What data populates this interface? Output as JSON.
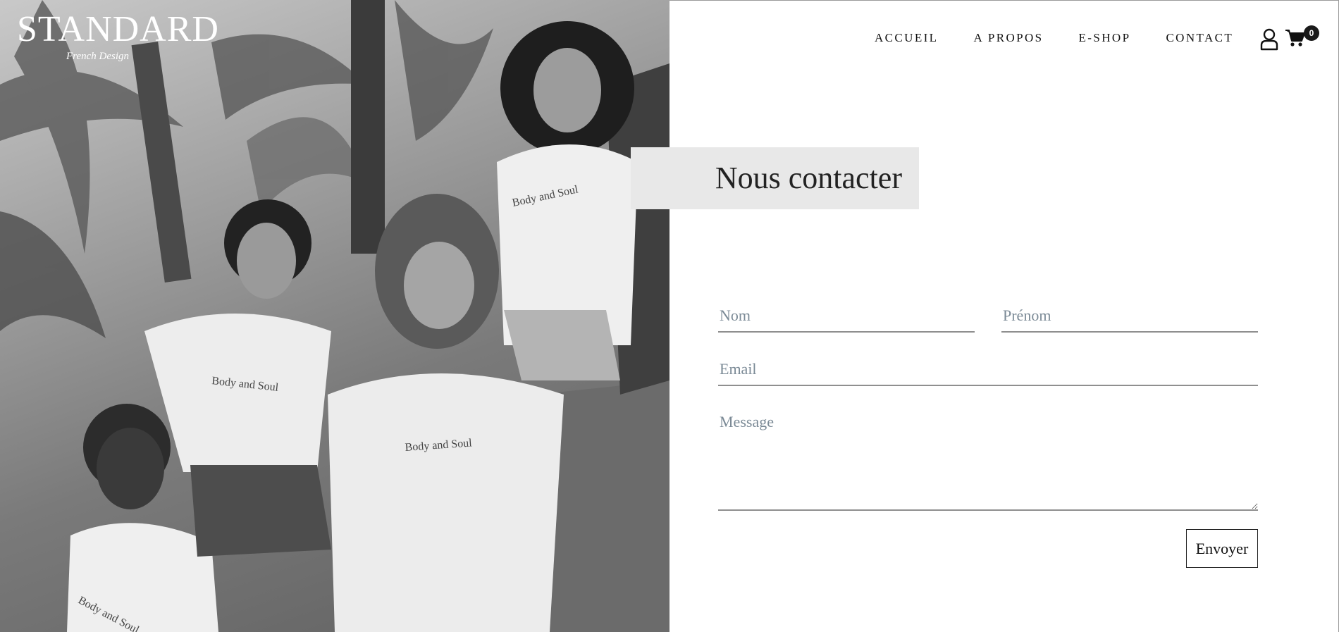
{
  "brand": {
    "name": "STANDARD",
    "tagline": "French Design"
  },
  "nav": {
    "items": [
      {
        "label": "ACCUEIL"
      },
      {
        "label": "A PROPOS"
      },
      {
        "label": "E-SHOP"
      },
      {
        "label": "CONTACT"
      }
    ],
    "cart_count": "0",
    "icons": {
      "account": "user-icon",
      "cart": "shopping-cart-icon"
    }
  },
  "hero": {
    "shirt_print": "Body and Soul"
  },
  "contact": {
    "title": "Nous contacter",
    "form": {
      "nom_placeholder": "Nom",
      "prenom_placeholder": "Prénom",
      "email_placeholder": "Email",
      "message_placeholder": "Message",
      "submit_label": "Envoyer"
    }
  },
  "colors": {
    "title_box_bg": "#e8e8e8",
    "field_underline": "#8f8f8f",
    "placeholder": "#7b8a96",
    "badge_bg": "#1a1a1a"
  }
}
